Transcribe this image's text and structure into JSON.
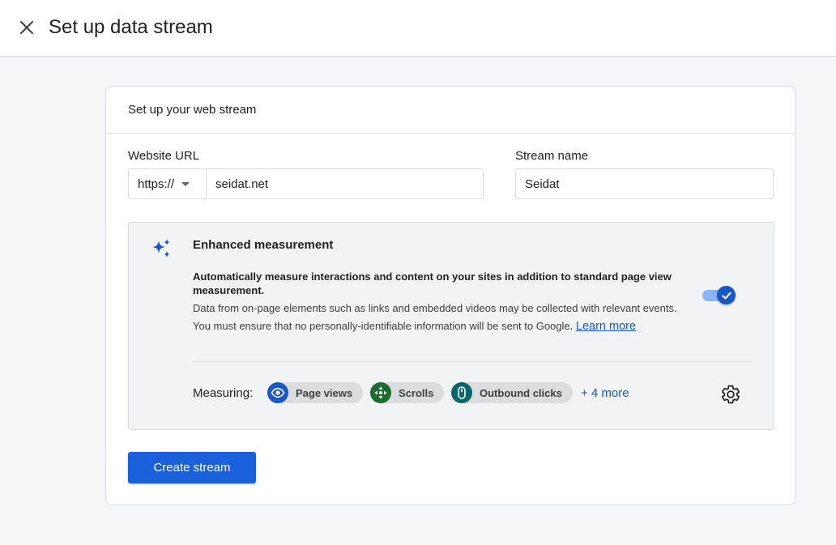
{
  "header": {
    "title": "Set up data stream",
    "close_icon": "close-icon"
  },
  "card": {
    "title": "Set up your web stream",
    "website_url": {
      "label": "Website URL",
      "protocol": "https://",
      "value": "seidat.net"
    },
    "stream_name": {
      "label": "Stream name",
      "value": "Seidat"
    },
    "enhanced_measurement": {
      "title": "Enhanced measurement",
      "description_bold": "Automatically measure interactions and content on your sites in addition to standard page view measurement.",
      "description": "Data from on-page elements such as links and embedded videos may be collected with relevant events. You must ensure that no personally-identifiable information will be sent to Google.",
      "learn_more": "Learn more",
      "enabled": true,
      "measuring_label": "Measuring:",
      "chips": [
        {
          "label": "Page views",
          "icon": "eye-icon",
          "color": "#1a56c4"
        },
        {
          "label": "Scrolls",
          "icon": "scroll-arrows-icon",
          "color": "#1e6b30"
        },
        {
          "label": "Outbound clicks",
          "icon": "mouse-icon",
          "color": "#0b6468"
        }
      ],
      "more": "+ 4 more"
    },
    "create_button": "Create stream"
  },
  "colors": {
    "accent": "#1a5fdc",
    "link": "#1a56c4",
    "background": "#f4f5f8"
  }
}
